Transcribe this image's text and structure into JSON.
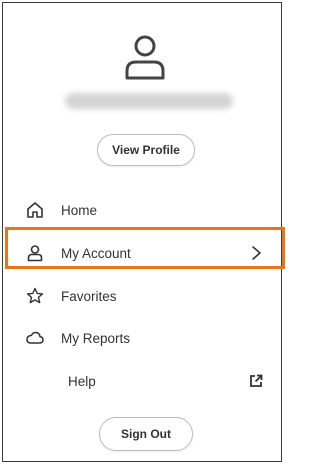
{
  "profile": {
    "icon": "user-icon",
    "view_profile_label": "View Profile"
  },
  "menu": {
    "items": [
      {
        "label": "Home",
        "icon": "home-icon"
      },
      {
        "label": "My Account",
        "icon": "user-icon",
        "selected": true
      },
      {
        "label": "Favorites",
        "icon": "star-icon"
      },
      {
        "label": "My Reports",
        "icon": "cloud-icon"
      },
      {
        "label": "Help",
        "icon": "external-link-icon"
      }
    ]
  },
  "sign_out_label": "Sign Out",
  "colors": {
    "highlight": "#e8751a",
    "text": "#333333",
    "border": "#bdbdbd"
  }
}
